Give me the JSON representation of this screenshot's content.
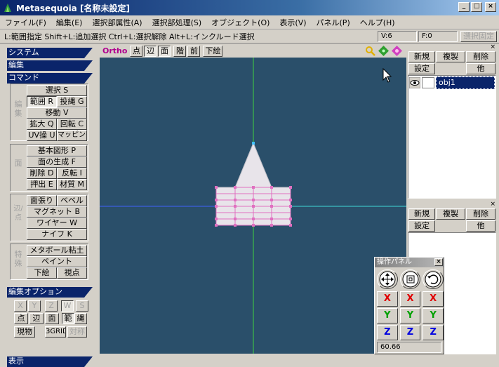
{
  "window": {
    "title": "Metasequoia [名称未設定]",
    "min": "_",
    "max": "□",
    "close": "×"
  },
  "menu": [
    "ファイル(F)",
    "編集(E)",
    "選択部属性(A)",
    "選択部処理(S)",
    "オブジェクト(O)",
    "表示(V)",
    "パネル(P)",
    "ヘルプ(H)"
  ],
  "status": {
    "hint": "L:範囲指定  Shift+L:追加選択  Ctrl+L:選択解除  Alt+L:インクルード選択",
    "vertices": "V:6",
    "faces": "F:0",
    "fix": "選択固定"
  },
  "sidebar": {
    "system": "システム",
    "edit": "編集",
    "command": "コマンド",
    "select": "選択 S",
    "edit_group": "編集",
    "range": "範囲 R",
    "lasso": "投縄 G",
    "move": "移動 V",
    "scale": "拡大 Q",
    "rotate": "回転 C",
    "uv": "UV操 U",
    "mapping": "マッピング",
    "face_group": "面",
    "basic_shape": "基本図形 P",
    "face_gen": "面の生成 F",
    "delete": "削除 D",
    "flip": "反転 I",
    "extrude": "押出 E",
    "material": "材質 M",
    "edge_group": "辺/点",
    "knife_edge": "面張り",
    "bevel": "ベベル",
    "magnet": "マグネット B",
    "wire": "ワイヤー W",
    "knife": "ナイフ K",
    "special_group": "特殊",
    "metaball": "メタボール粘土",
    "paint": "ペイント",
    "sketch": "下絵",
    "viewpoint": "視点",
    "edit_options": "編集オプション",
    "axis": [
      "X",
      "Y",
      "Z",
      "W",
      "S"
    ],
    "pt": "点",
    "edge": "辺",
    "face": "面",
    "range2": "範",
    "lasso2": "縄",
    "current": "現物",
    "grid3d": "3GRID",
    "symmetry": "対称",
    "display": "表示"
  },
  "viewtoolbar": {
    "mode": "Ortho",
    "pt": "点",
    "edge": "辺",
    "face": "面",
    "stage": "階",
    "front": "前",
    "sketch": "下絵"
  },
  "objpanel": {
    "new": "新規",
    "dup": "複製",
    "del": "削除",
    "settings": "設定",
    "other": "他",
    "object_name": "obj1"
  },
  "matpanel": {
    "new": "新規",
    "dup": "複製",
    "del": "削除",
    "settings": "設定",
    "other": "他"
  },
  "oppanel": {
    "title": "操作パネル",
    "x": "X",
    "y": "Y",
    "z": "Z",
    "value": "60.66"
  },
  "colors": {
    "accent": "#0a246a",
    "viewport": "#2a4f6a",
    "vertex": "#e070c0",
    "x": "#e00000",
    "y": "#00a000",
    "z": "#0000e0"
  }
}
